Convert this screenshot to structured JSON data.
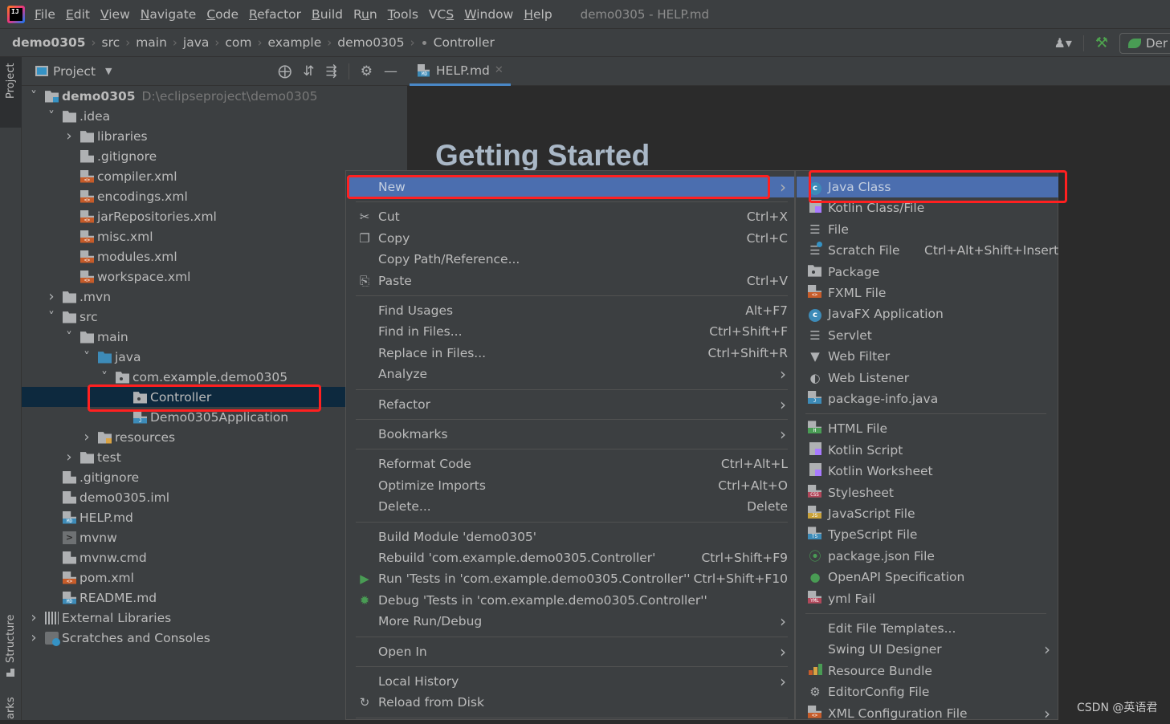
{
  "menubar": {
    "items": [
      "File",
      "Edit",
      "View",
      "Navigate",
      "Code",
      "Refactor",
      "Build",
      "Run",
      "Tools",
      "VCS",
      "Window",
      "Help"
    ],
    "mnemonics": [
      "F",
      "E",
      "V",
      "N",
      "C",
      "R",
      "B",
      "u",
      "T",
      "S",
      "W",
      "H"
    ],
    "window_title": "demo0305 - HELP.md"
  },
  "breadcrumb": {
    "items": [
      "demo0305",
      "src",
      "main",
      "java",
      "com",
      "example",
      "demo0305",
      "Controller"
    ],
    "run_config": "Der"
  },
  "side_strip": {
    "project_label": "Project",
    "structure_label": "Structure",
    "bookmarks_label": "arks"
  },
  "project_panel": {
    "title": "Project",
    "tools": [
      "locate-icon",
      "expand-all-icon",
      "collapse-all-icon",
      "gear-icon",
      "hide-icon"
    ],
    "tree": [
      {
        "label": "demo0305",
        "path": "D:\\eclipseproject\\demo0305",
        "depth": 0,
        "arrow": "down",
        "icon": "module",
        "bold": true
      },
      {
        "label": ".idea",
        "depth": 1,
        "arrow": "down",
        "icon": "folder"
      },
      {
        "label": "libraries",
        "depth": 2,
        "arrow": "right",
        "icon": "folder"
      },
      {
        "label": ".gitignore",
        "depth": 2,
        "icon": "ignore"
      },
      {
        "label": "compiler.xml",
        "depth": 2,
        "icon": "xml"
      },
      {
        "label": "encodings.xml",
        "depth": 2,
        "icon": "xml"
      },
      {
        "label": "jarRepositories.xml",
        "depth": 2,
        "icon": "xml"
      },
      {
        "label": "misc.xml",
        "depth": 2,
        "icon": "xml"
      },
      {
        "label": "modules.xml",
        "depth": 2,
        "icon": "xml"
      },
      {
        "label": "workspace.xml",
        "depth": 2,
        "icon": "xml"
      },
      {
        "label": ".mvn",
        "depth": 1,
        "arrow": "right",
        "icon": "folder"
      },
      {
        "label": "src",
        "depth": 1,
        "arrow": "down",
        "icon": "folder"
      },
      {
        "label": "main",
        "depth": 2,
        "arrow": "down",
        "icon": "folder"
      },
      {
        "label": "java",
        "depth": 3,
        "arrow": "down",
        "icon": "folder-blue"
      },
      {
        "label": "com.example.demo0305",
        "depth": 4,
        "arrow": "down",
        "icon": "package"
      },
      {
        "label": "Controller",
        "depth": 5,
        "icon": "package",
        "selected": true
      },
      {
        "label": "Demo0305Application",
        "depth": 5,
        "icon": "java"
      },
      {
        "label": "resources",
        "depth": 3,
        "arrow": "right",
        "icon": "folder-res"
      },
      {
        "label": "test",
        "depth": 2,
        "arrow": "right",
        "icon": "folder"
      },
      {
        "label": ".gitignore",
        "depth": 1,
        "icon": "ignore"
      },
      {
        "label": "demo0305.iml",
        "depth": 1,
        "icon": "iml"
      },
      {
        "label": "HELP.md",
        "depth": 1,
        "icon": "md"
      },
      {
        "label": "mvnw",
        "depth": 1,
        "icon": "shell"
      },
      {
        "label": "mvnw.cmd",
        "depth": 1,
        "icon": "text"
      },
      {
        "label": "pom.xml",
        "depth": 1,
        "icon": "xml"
      },
      {
        "label": "README.md",
        "depth": 1,
        "icon": "md"
      },
      {
        "label": "External Libraries",
        "depth": 0,
        "arrow": "right",
        "icon": "libs"
      },
      {
        "label": "Scratches and Consoles",
        "depth": 0,
        "arrow": "right",
        "icon": "scratch"
      }
    ]
  },
  "editor": {
    "tab_label": "HELP.md",
    "heading": "Getting Started"
  },
  "context_menu": {
    "items": [
      {
        "label": "New",
        "submenu": true,
        "highlighted": true
      },
      {
        "sep": true
      },
      {
        "label": "Cut",
        "shortcut": "Ctrl+X",
        "icon": "scissors-icon"
      },
      {
        "label": "Copy",
        "shortcut": "Ctrl+C",
        "icon": "copy-icon"
      },
      {
        "label": "Copy Path/Reference..."
      },
      {
        "label": "Paste",
        "shortcut": "Ctrl+V",
        "icon": "paste-icon"
      },
      {
        "sep": true
      },
      {
        "label": "Find Usages",
        "shortcut": "Alt+F7"
      },
      {
        "label": "Find in Files...",
        "shortcut": "Ctrl+Shift+F"
      },
      {
        "label": "Replace in Files...",
        "shortcut": "Ctrl+Shift+R"
      },
      {
        "label": "Analyze",
        "submenu": true
      },
      {
        "sep": true
      },
      {
        "label": "Refactor",
        "submenu": true
      },
      {
        "sep": true
      },
      {
        "label": "Bookmarks",
        "submenu": true
      },
      {
        "sep": true
      },
      {
        "label": "Reformat Code",
        "shortcut": "Ctrl+Alt+L"
      },
      {
        "label": "Optimize Imports",
        "shortcut": "Ctrl+Alt+O"
      },
      {
        "label": "Delete...",
        "shortcut": "Delete"
      },
      {
        "sep": true
      },
      {
        "label": "Build Module 'demo0305'"
      },
      {
        "label": "Rebuild 'com.example.demo0305.Controller'",
        "shortcut": "Ctrl+Shift+F9"
      },
      {
        "label": "Run 'Tests in 'com.example.demo0305.Controller''",
        "shortcut": "Ctrl+Shift+F10",
        "icon": "run-icon"
      },
      {
        "label": "Debug 'Tests in 'com.example.demo0305.Controller''",
        "icon": "debug-icon"
      },
      {
        "label": "More Run/Debug",
        "submenu": true
      },
      {
        "sep": true
      },
      {
        "label": "Open In",
        "submenu": true
      },
      {
        "sep": true
      },
      {
        "label": "Local History",
        "submenu": true
      },
      {
        "label": "Reload from Disk",
        "icon": "reload-icon"
      },
      {
        "sep": true
      }
    ]
  },
  "new_submenu": {
    "items": [
      {
        "label": "Java Class",
        "icon": "java-class-icon",
        "highlighted": true
      },
      {
        "label": "Kotlin Class/File",
        "icon": "kotlin-icon"
      },
      {
        "label": "File",
        "icon": "file-icon"
      },
      {
        "label": "Scratch File",
        "shortcut": "Ctrl+Alt+Shift+Insert",
        "icon": "scratch-file-icon"
      },
      {
        "label": "Package",
        "icon": "package-icon"
      },
      {
        "label": "FXML File",
        "icon": "fxml-icon"
      },
      {
        "label": "JavaFX Application",
        "icon": "javafx-icon"
      },
      {
        "label": "Servlet",
        "icon": "servlet-icon"
      },
      {
        "label": "Web Filter",
        "icon": "filter-icon"
      },
      {
        "label": "Web Listener",
        "icon": "listener-icon"
      },
      {
        "label": "package-info.java",
        "icon": "package-info-icon"
      },
      {
        "sep": true
      },
      {
        "label": "HTML File",
        "icon": "html-icon"
      },
      {
        "label": "Kotlin Script",
        "icon": "kotlin-script-icon"
      },
      {
        "label": "Kotlin Worksheet",
        "icon": "kotlin-worksheet-icon"
      },
      {
        "label": "Stylesheet",
        "icon": "css-icon"
      },
      {
        "label": "JavaScript File",
        "icon": "js-icon"
      },
      {
        "label": "TypeScript File",
        "icon": "ts-icon"
      },
      {
        "label": "package.json File",
        "icon": "nodejs-icon"
      },
      {
        "label": "OpenAPI Specification",
        "icon": "openapi-icon"
      },
      {
        "label": "yml Fail",
        "icon": "yml-icon"
      },
      {
        "sep": true
      },
      {
        "label": "Edit File Templates..."
      },
      {
        "label": "Swing UI Designer",
        "submenu": true
      },
      {
        "label": "Resource Bundle",
        "icon": "resource-bundle-icon"
      },
      {
        "label": "EditorConfig File",
        "icon": "editorconfig-icon"
      },
      {
        "label": "XML Configuration File",
        "submenu": true,
        "icon": "xml-config-icon"
      }
    ]
  },
  "watermark": "CSDN @英语君",
  "colors": {
    "highlight": "#4b6eaf",
    "selection": "#0d293e",
    "annotation_red": "#ff2020",
    "panel_bg": "#3c3f41",
    "editor_bg": "#2b2b2b"
  }
}
